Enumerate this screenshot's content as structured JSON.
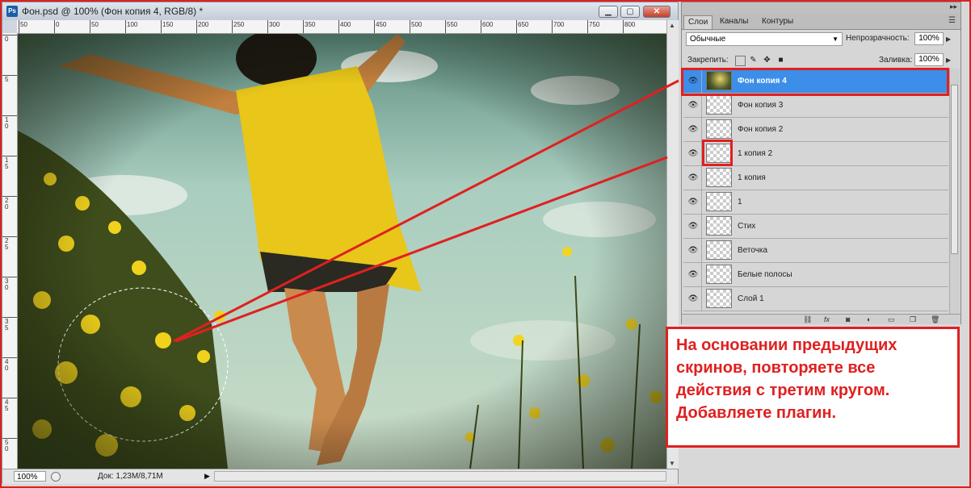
{
  "document": {
    "title": "Фон.psd @ 100% (Фон копия 4, RGB/8) *",
    "app_icon_label": "Ps",
    "window_buttons": [
      "minimize",
      "restore",
      "close"
    ],
    "ruler_top_labels": [
      "50",
      "0",
      "50",
      "100",
      "150",
      "200",
      "250",
      "300",
      "350",
      "400",
      "450",
      "500",
      "550",
      "600",
      "650",
      "700",
      "750",
      "800"
    ],
    "ruler_left_labels": [
      "0",
      "5",
      "1\n0",
      "1\n5",
      "2\n0",
      "2\n5",
      "3\n0",
      "3\n5",
      "4\n0",
      "4\n5",
      "5\n0"
    ],
    "zoom": "100%",
    "doc_info": "Док: 1,23M/8,71M"
  },
  "layers_panel": {
    "tabs": [
      "Слои",
      "Каналы",
      "Контуры"
    ],
    "blend_mode": "Обычные",
    "opacity_label": "Непрозрачность:",
    "opacity_value": "100%",
    "lock_label": "Закрепить:",
    "fill_label": "Заливка:",
    "fill_value": "100%",
    "layers": [
      {
        "name": "Фон копия 4",
        "selected": true,
        "thumb": "photo"
      },
      {
        "name": "Фон копия 3",
        "selected": false,
        "thumb": "transparent"
      },
      {
        "name": "Фон копия 2",
        "selected": false,
        "thumb": "transparent"
      },
      {
        "name": "1 копия 2",
        "selected": false,
        "thumb": "transparent"
      },
      {
        "name": "1 копия",
        "selected": false,
        "thumb": "transparent"
      },
      {
        "name": "1",
        "selected": false,
        "thumb": "transparent"
      },
      {
        "name": "Стих",
        "selected": false,
        "thumb": "transparent"
      },
      {
        "name": "Веточка",
        "selected": false,
        "thumb": "transparent"
      },
      {
        "name": "Белые полосы",
        "selected": false,
        "thumb": "transparent"
      },
      {
        "name": "Слой 1",
        "selected": false,
        "thumb": "transparent"
      }
    ],
    "bottom_icons": [
      "link-icon",
      "fx-icon",
      "mask-icon",
      "adjustment-icon",
      "folder-icon",
      "new-layer-icon",
      "trash-icon"
    ]
  },
  "callout": {
    "text": "На основании предыдущих скринов, повторяете все действия с третим кругом. Добавляете плагин."
  },
  "colors": {
    "highlight_red": "#e02020",
    "selection_blue": "#3d8ee8"
  }
}
